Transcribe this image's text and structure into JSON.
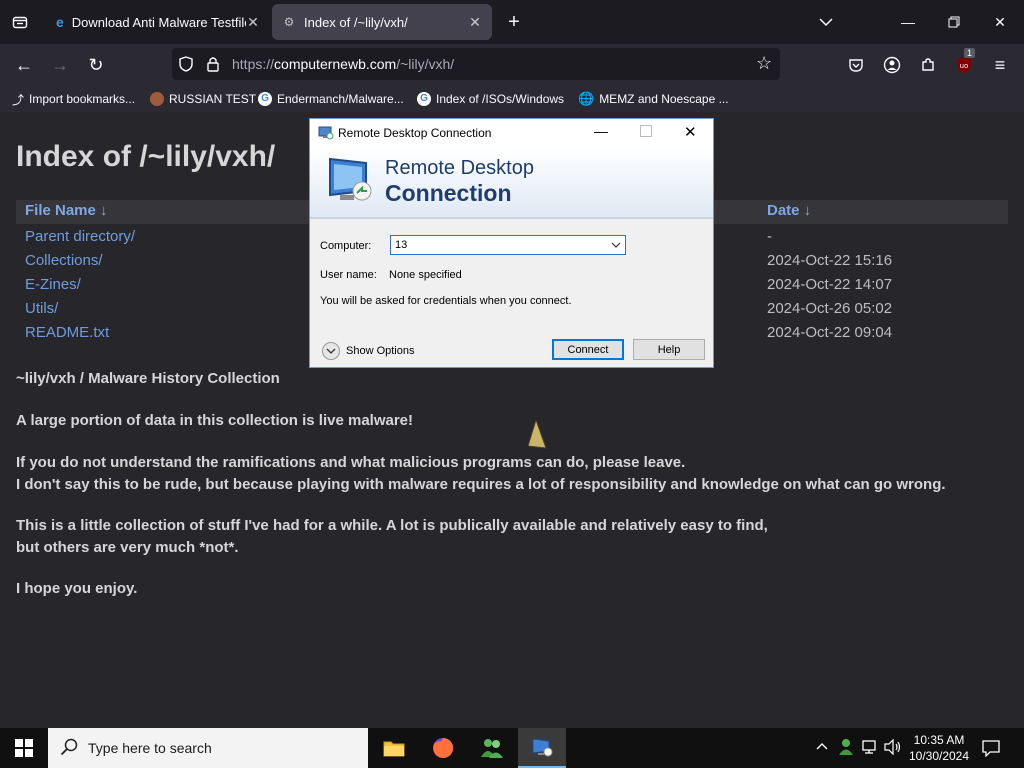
{
  "browser": {
    "tabs": [
      {
        "title": "Download Anti Malware Testfile",
        "active": false
      },
      {
        "title": "Index of /~lily/vxh/",
        "active": true
      }
    ],
    "url_prefix": "https://",
    "url_host": "computernewb.com",
    "url_path": "/~lily/vxh/",
    "extension_badge": "1",
    "bookmarks": [
      "Import bookmarks...",
      "RUSSIAN TEST",
      "Endermanch/Malware...",
      "Index of /ISOs/Windows",
      "MEMZ and Noescape ..."
    ]
  },
  "page": {
    "title": "Index of /~lily/vxh/",
    "columns": {
      "name": "File Name  ↓",
      "date": "Date  ↓"
    },
    "rows": [
      {
        "name": "Parent directory/",
        "date": "-"
      },
      {
        "name": "Collections/",
        "date": "2024-Oct-22 15:16"
      },
      {
        "name": "E-Zines/",
        "date": "2024-Oct-22 14:07"
      },
      {
        "name": "Utils/",
        "date": "2024-Oct-26 05:02"
      },
      {
        "name": "README.txt",
        "date": "2024-Oct-22 09:04"
      }
    ],
    "paragraphs": [
      "~lily/vxh / Malware History Collection",
      "A large portion of data in this collection is live malware!",
      "If you do not understand the ramifications and what malicious programs can do, please leave.",
      "I don't say this to be rude, but because playing with malware requires a lot of responsibility and knowledge on what can go wrong.",
      "This is a little collection of stuff I've had for a while. A lot is publically available and relatively easy to find,",
      "but others are very much *not*.",
      "I hope you enjoy."
    ]
  },
  "dialog": {
    "title": "Remote Desktop Connection",
    "banner_line1": "Remote Desktop",
    "banner_line2": "Connection",
    "computer_label": "Computer:",
    "computer_value": "13",
    "username_label": "User name:",
    "username_value": "None specified",
    "info": "You will be asked for credentials when you connect.",
    "show_options": "Show Options",
    "connect": "Connect",
    "help": "Help"
  },
  "taskbar": {
    "search_placeholder": "Type here to search",
    "time": "10:35 AM",
    "date": "10/30/2024"
  },
  "colors": {
    "accent": "#0078d7",
    "link": "#6f9ce0"
  }
}
